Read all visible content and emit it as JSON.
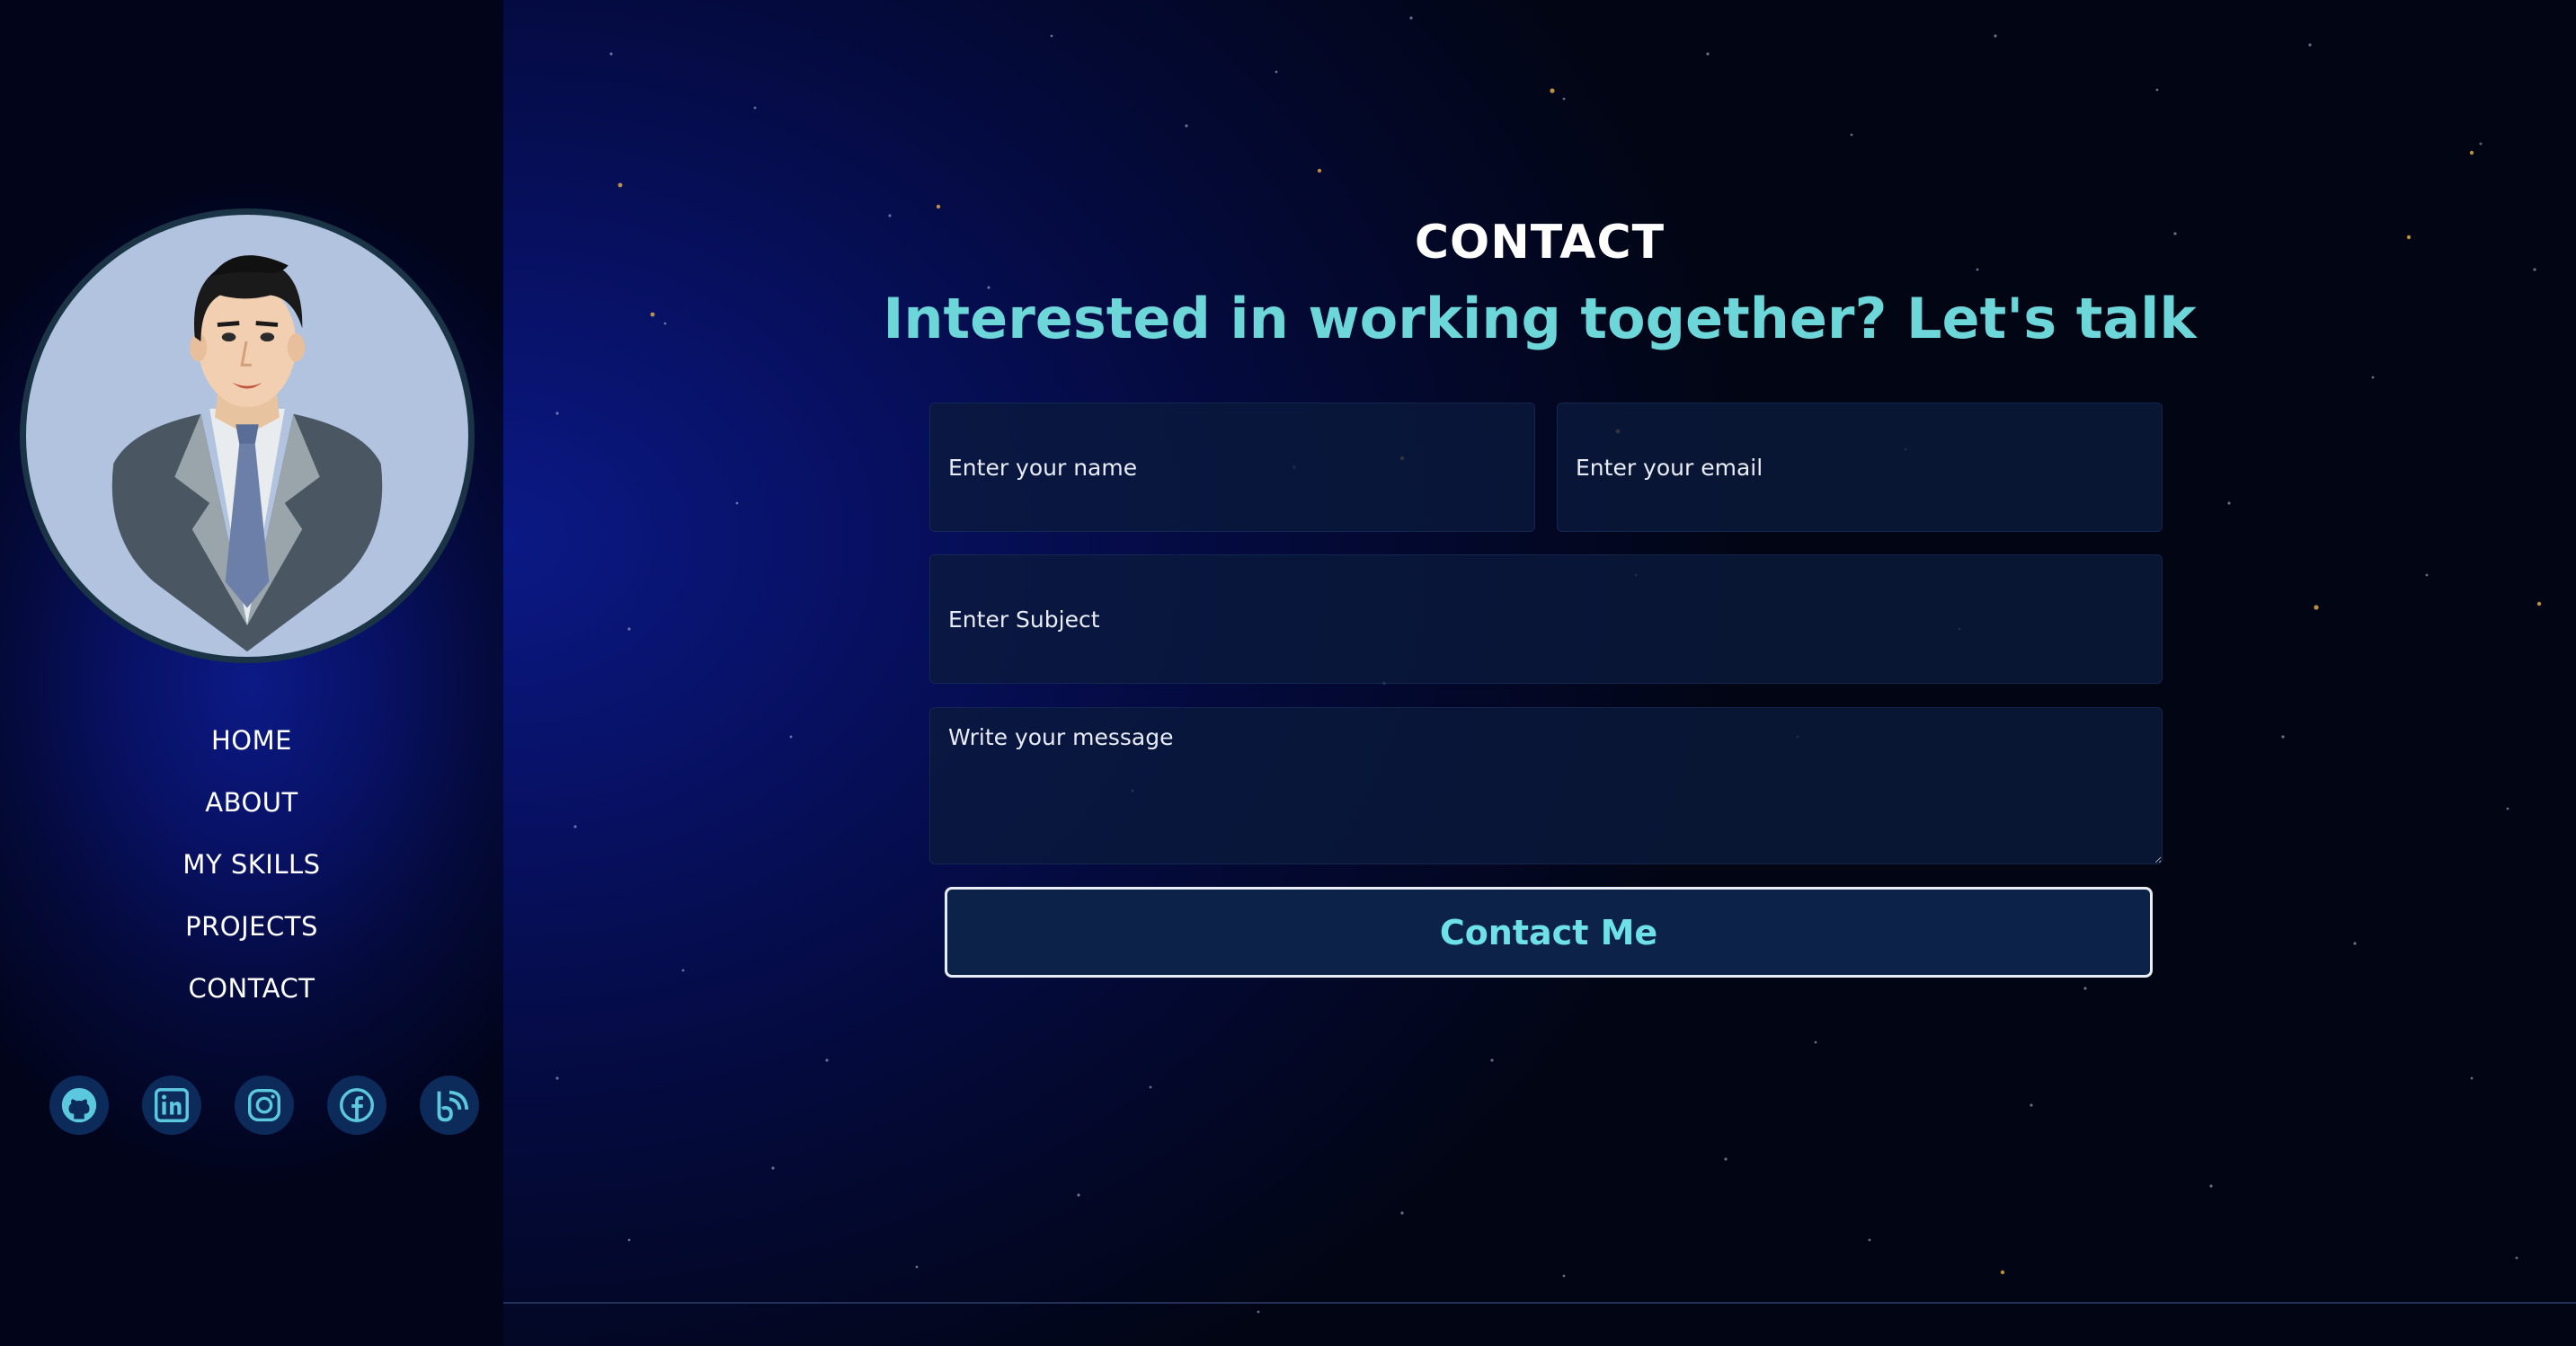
{
  "nav": {
    "items": [
      {
        "label": "HOME"
      },
      {
        "label": "ABOUT"
      },
      {
        "label": "MY SKILLS"
      },
      {
        "label": "PROJECTS"
      },
      {
        "label": "CONTACT"
      }
    ]
  },
  "socials": [
    {
      "icon": "github-icon"
    },
    {
      "icon": "linkedin-icon"
    },
    {
      "icon": "instagram-icon"
    },
    {
      "icon": "facebook-icon"
    },
    {
      "icon": "blog-icon"
    }
  ],
  "contact": {
    "label": "CONTACT",
    "headline": "Interested in working together? Let's talk",
    "name_placeholder": "Enter your name",
    "email_placeholder": "Enter your email",
    "subject_placeholder": "Enter Subject",
    "message_placeholder": "Write your message",
    "button_label": "Contact Me"
  },
  "colors": {
    "accent": "#6dd6d8",
    "icon": "#5cc8e0",
    "background": "#040a3b"
  }
}
